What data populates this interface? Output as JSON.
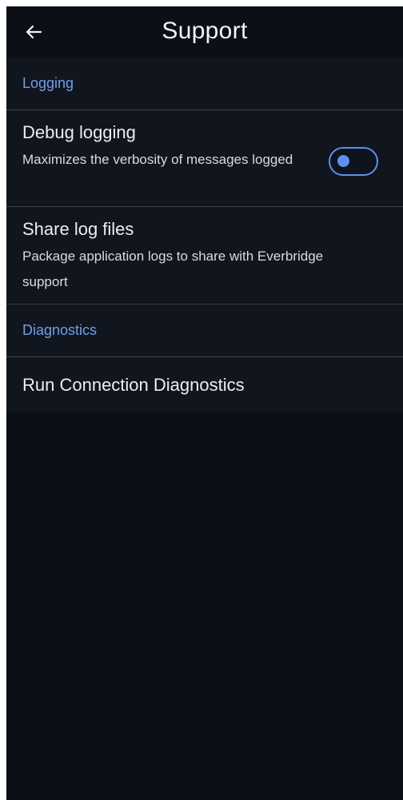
{
  "header": {
    "title": "Support",
    "back_icon": "arrow-left-icon"
  },
  "sections": [
    {
      "header": "Logging",
      "items": [
        {
          "title": "Debug logging",
          "description": "Maximizes the verbosity of messages logged",
          "toggle": {
            "on": false,
            "icon": "toggle-switch-icon"
          }
        },
        {
          "title": "Share log files",
          "description": "Package application logs to share with Everbridge support"
        }
      ]
    },
    {
      "header": "Diagnostics",
      "items": [
        {
          "title": "Run Connection Diagnostics"
        }
      ]
    }
  ],
  "colors": {
    "background": "#0b0e14",
    "surface": "#11151d",
    "accent": "#5d8ef0",
    "section_header_text": "#6f9ff0",
    "divider": "#3a3f4a",
    "text": "#eceef2"
  }
}
